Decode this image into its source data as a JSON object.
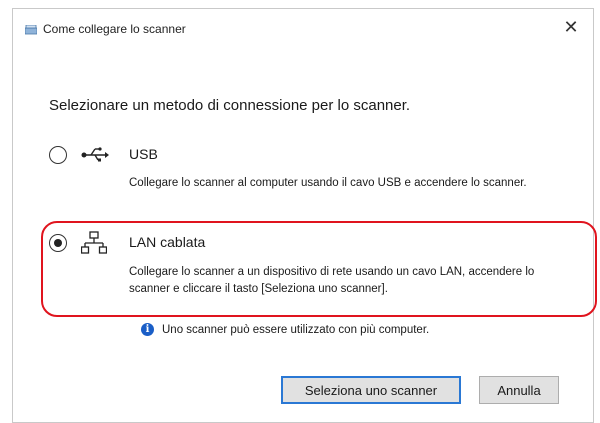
{
  "window": {
    "title": "Come collegare lo scanner",
    "close_glyph": "✕"
  },
  "prompt": "Selezionare un metodo di connessione per lo scanner.",
  "options": [
    {
      "label": "USB",
      "description": "Collegare lo scanner al computer usando il cavo USB e accendere lo scanner.",
      "selected": false,
      "icon": "usb-icon"
    },
    {
      "label": "LAN cablata",
      "description": "Collegare lo scanner a un dispositivo di rete usando un cavo LAN, accendere lo scanner e cliccare il tasto [Seleziona uno scanner].",
      "selected": true,
      "icon": "network-icon"
    }
  ],
  "note": {
    "icon": "info-icon",
    "text": "Uno scanner può essere utilizzato con più computer."
  },
  "buttons": {
    "select_scanner": "Seleziona uno scanner",
    "cancel": "Annulla"
  },
  "colors": {
    "highlight": "#e0141e",
    "info": "#1a5ec7",
    "primary_border": "#2a78d4"
  }
}
